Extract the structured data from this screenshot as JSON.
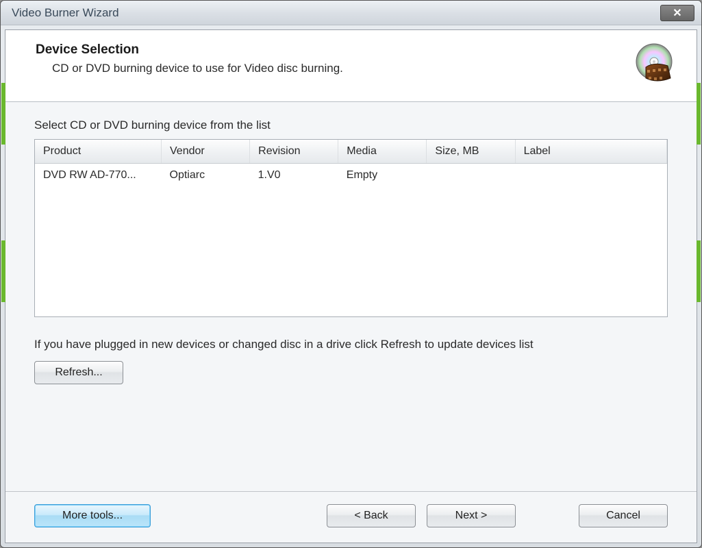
{
  "window": {
    "title": "Video Burner Wizard"
  },
  "header": {
    "title": "Device Selection",
    "subtitle": "CD or DVD burning device to use for Video disc burning."
  },
  "main": {
    "list_label": "Select CD or DVD burning device from the list",
    "columns": {
      "product": "Product",
      "vendor": "Vendor",
      "revision": "Revision",
      "media": "Media",
      "size": "Size, MB",
      "label": "Label"
    },
    "rows": [
      {
        "product": "DVD RW AD-770...",
        "vendor": "Optiarc",
        "revision": "1.V0",
        "media": "Empty",
        "size": "",
        "label": ""
      }
    ],
    "refresh_hint": "If you have plugged in new devices or changed disc in a drive click Refresh to update devices list",
    "refresh_label": "Refresh..."
  },
  "buttons": {
    "more_tools": "More tools...",
    "back": "< Back",
    "next": "Next >",
    "cancel": "Cancel"
  }
}
